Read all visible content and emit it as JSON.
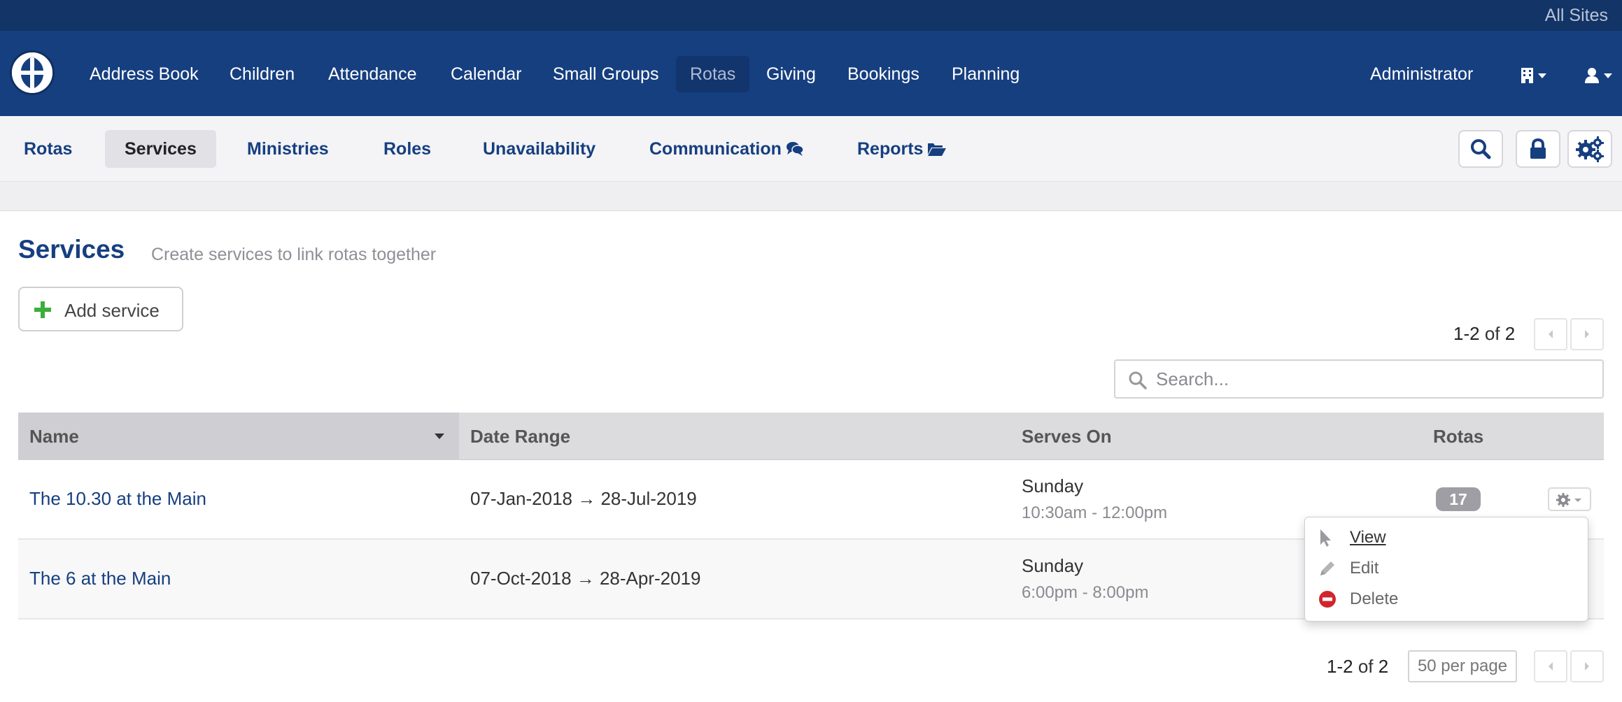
{
  "topstrip": {
    "all_sites": "All Sites"
  },
  "nav": {
    "items": [
      "Address Book",
      "Children",
      "Attendance",
      "Calendar",
      "Small Groups",
      "Rotas",
      "Giving",
      "Bookings",
      "Planning"
    ],
    "active": "Rotas",
    "user": "Administrator",
    "icons": [
      "building-icon",
      "user-icon"
    ]
  },
  "subnav": {
    "items": [
      "Rotas",
      "Services",
      "Ministries",
      "Roles",
      "Unavailability",
      "Communication",
      "Reports"
    ],
    "active": "Services",
    "buttons": [
      "search-icon",
      "lock-icon",
      "cogs-icon"
    ]
  },
  "page": {
    "title": "Services",
    "subtitle": "Create services to link rotas together",
    "add_button": "Add service"
  },
  "pager_top": {
    "range": "1-2",
    "of": "of",
    "total": "2"
  },
  "search": {
    "placeholder": "Search..."
  },
  "table": {
    "headers": [
      "Name",
      "Date Range",
      "Serves On",
      "Rotas"
    ],
    "rows": [
      {
        "name": "The 10.30 at the Main",
        "date_range": "07-Jan-2018 → 28-Jul-2019",
        "day": "Sunday",
        "time": "10:30am - 12:00pm",
        "rotas": "17"
      },
      {
        "name": "The 6 at the Main",
        "date_range": "07-Oct-2018 → 28-Apr-2019",
        "day": "Sunday",
        "time": "6:00pm - 8:00pm",
        "rotas": ""
      }
    ]
  },
  "dropdown": {
    "view": "View",
    "edit": "Edit",
    "delete": "Delete"
  },
  "pager_bottom": {
    "range": "1-2",
    "of": "of",
    "total": "2",
    "per_page": "50 per page"
  },
  "colors": {
    "nav_bg": "#163f80",
    "topstrip_bg": "#123466",
    "link": "#163f80",
    "add_green": "#3cae3c",
    "delete_red": "#d0262b"
  }
}
